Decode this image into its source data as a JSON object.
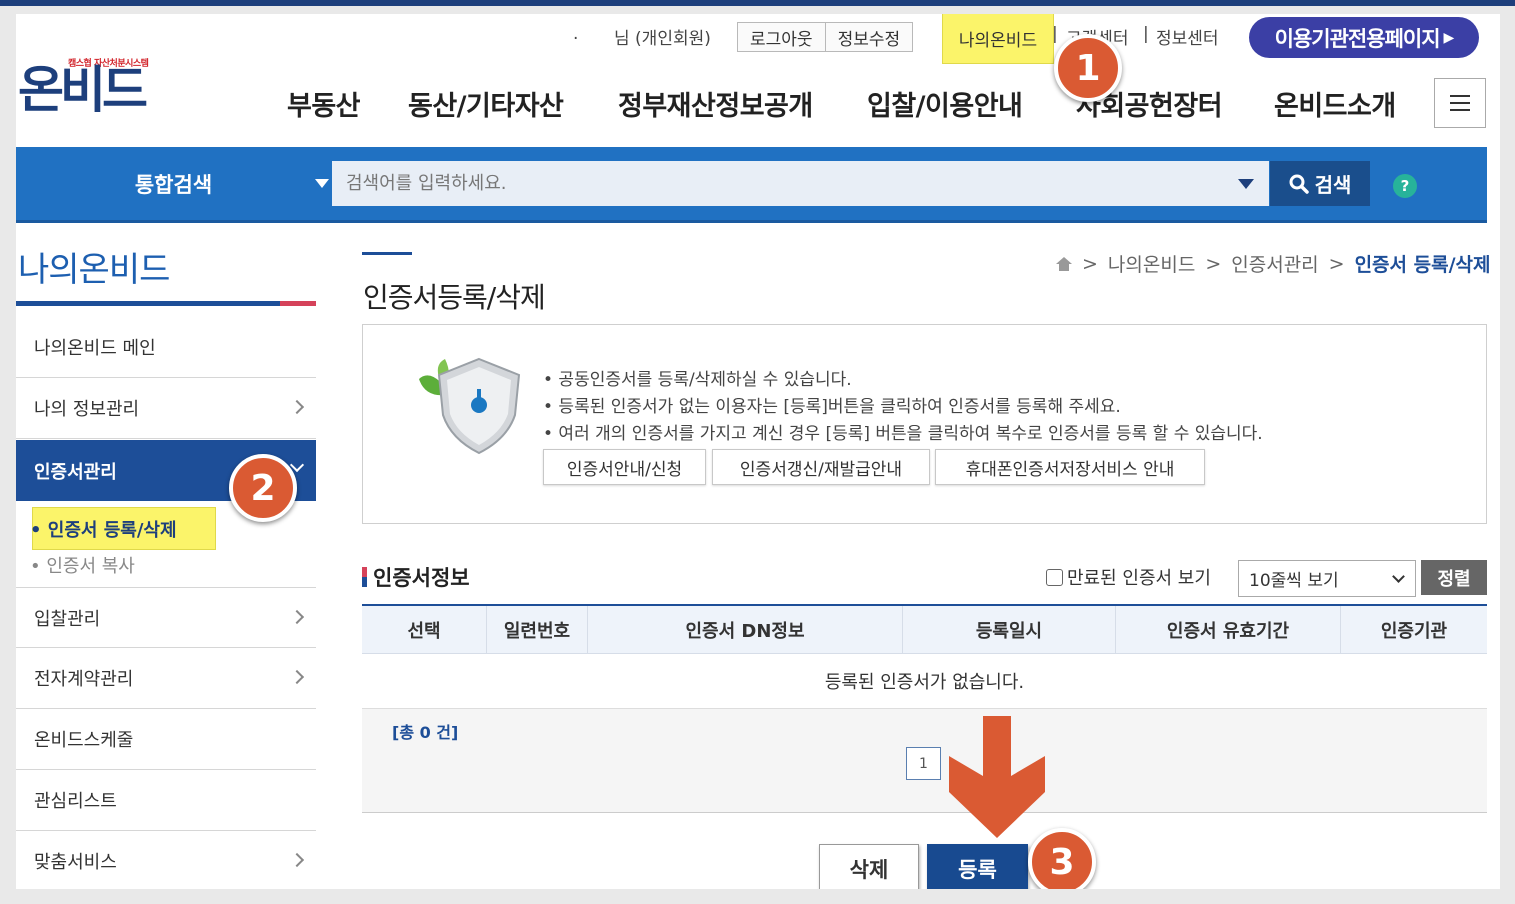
{
  "header": {
    "user_greeting": "님 (개인회원)",
    "dot": ".",
    "logout": "로그아웃",
    "edit_info": "정보수정",
    "my_onbid": "나의온비드",
    "customer_center": "고객센터",
    "info_center": "정보센터",
    "separator": "|",
    "partner_page": "이용기관전용페이지",
    "logo_subtitle": "캠스협 자산처분시스템",
    "logo": "온비드"
  },
  "gnb": [
    "부동산",
    "동산/기타자산",
    "정부재산정보공개",
    "입찰/이용안내",
    "사회공헌장터",
    "온비드소개"
  ],
  "search": {
    "scope": "통합검색",
    "placeholder": "검색어를 입력하세요.",
    "button": "검색",
    "help": "?"
  },
  "sidebar": {
    "title": "나의온비드",
    "items": [
      {
        "label": "나의온비드 메인"
      },
      {
        "label": "나의 정보관리"
      },
      {
        "label": "인증서관리"
      },
      {
        "label": "입찰관리"
      },
      {
        "label": "전자계약관리"
      },
      {
        "label": "온비드스케줄"
      },
      {
        "label": "관심리스트"
      },
      {
        "label": "맞춤서비스"
      }
    ],
    "sub_items": [
      {
        "label": "인증서 등록/삭제"
      },
      {
        "label": "인증서 복사"
      }
    ]
  },
  "breadcrumb": {
    "sep": ">",
    "level1": "나의온비드",
    "level2": "인증서관리",
    "current": "인증서 등록/삭제"
  },
  "page": {
    "title": "인증서등록/삭제",
    "info_lines": [
      "• 공동인증서를 등록/삭제하실 수 있습니다.",
      "• 등록된 인증서가 없는 이용자는 [등록]버튼을 클릭하여 인증서를 등록해 주세요.",
      "• 여러 개의 인증서를 가지고 계신 경우 [등록] 버튼을 클릭하여 복수로 인증서를 등록 할 수 있습니다."
    ],
    "guide_buttons": [
      "인증서안내/신청",
      "인증서갱신/재발급안내",
      "휴대폰인증서저장서비스 안내"
    ]
  },
  "cert_table": {
    "section_title": "인증서정보",
    "show_expired": "만료된 인증서 보기",
    "page_size": "10줄씩 보기",
    "sort": "정렬",
    "columns": [
      "선택",
      "일련번호",
      "인증서 DN정보",
      "등록일시",
      "인증서 유효기간",
      "인증기관"
    ],
    "empty_message": "등록된 인증서가 없습니다.",
    "total": "[총 0 건]",
    "current_page": "1"
  },
  "actions": {
    "delete": "삭제",
    "register": "등록"
  },
  "annotations": [
    "1",
    "2",
    "3"
  ],
  "colors": {
    "brand_navy": "#1d3f7c",
    "search_blue": "#2071c2",
    "highlight_yellow": "#fbf46a",
    "badge_orange": "#da5a33"
  }
}
